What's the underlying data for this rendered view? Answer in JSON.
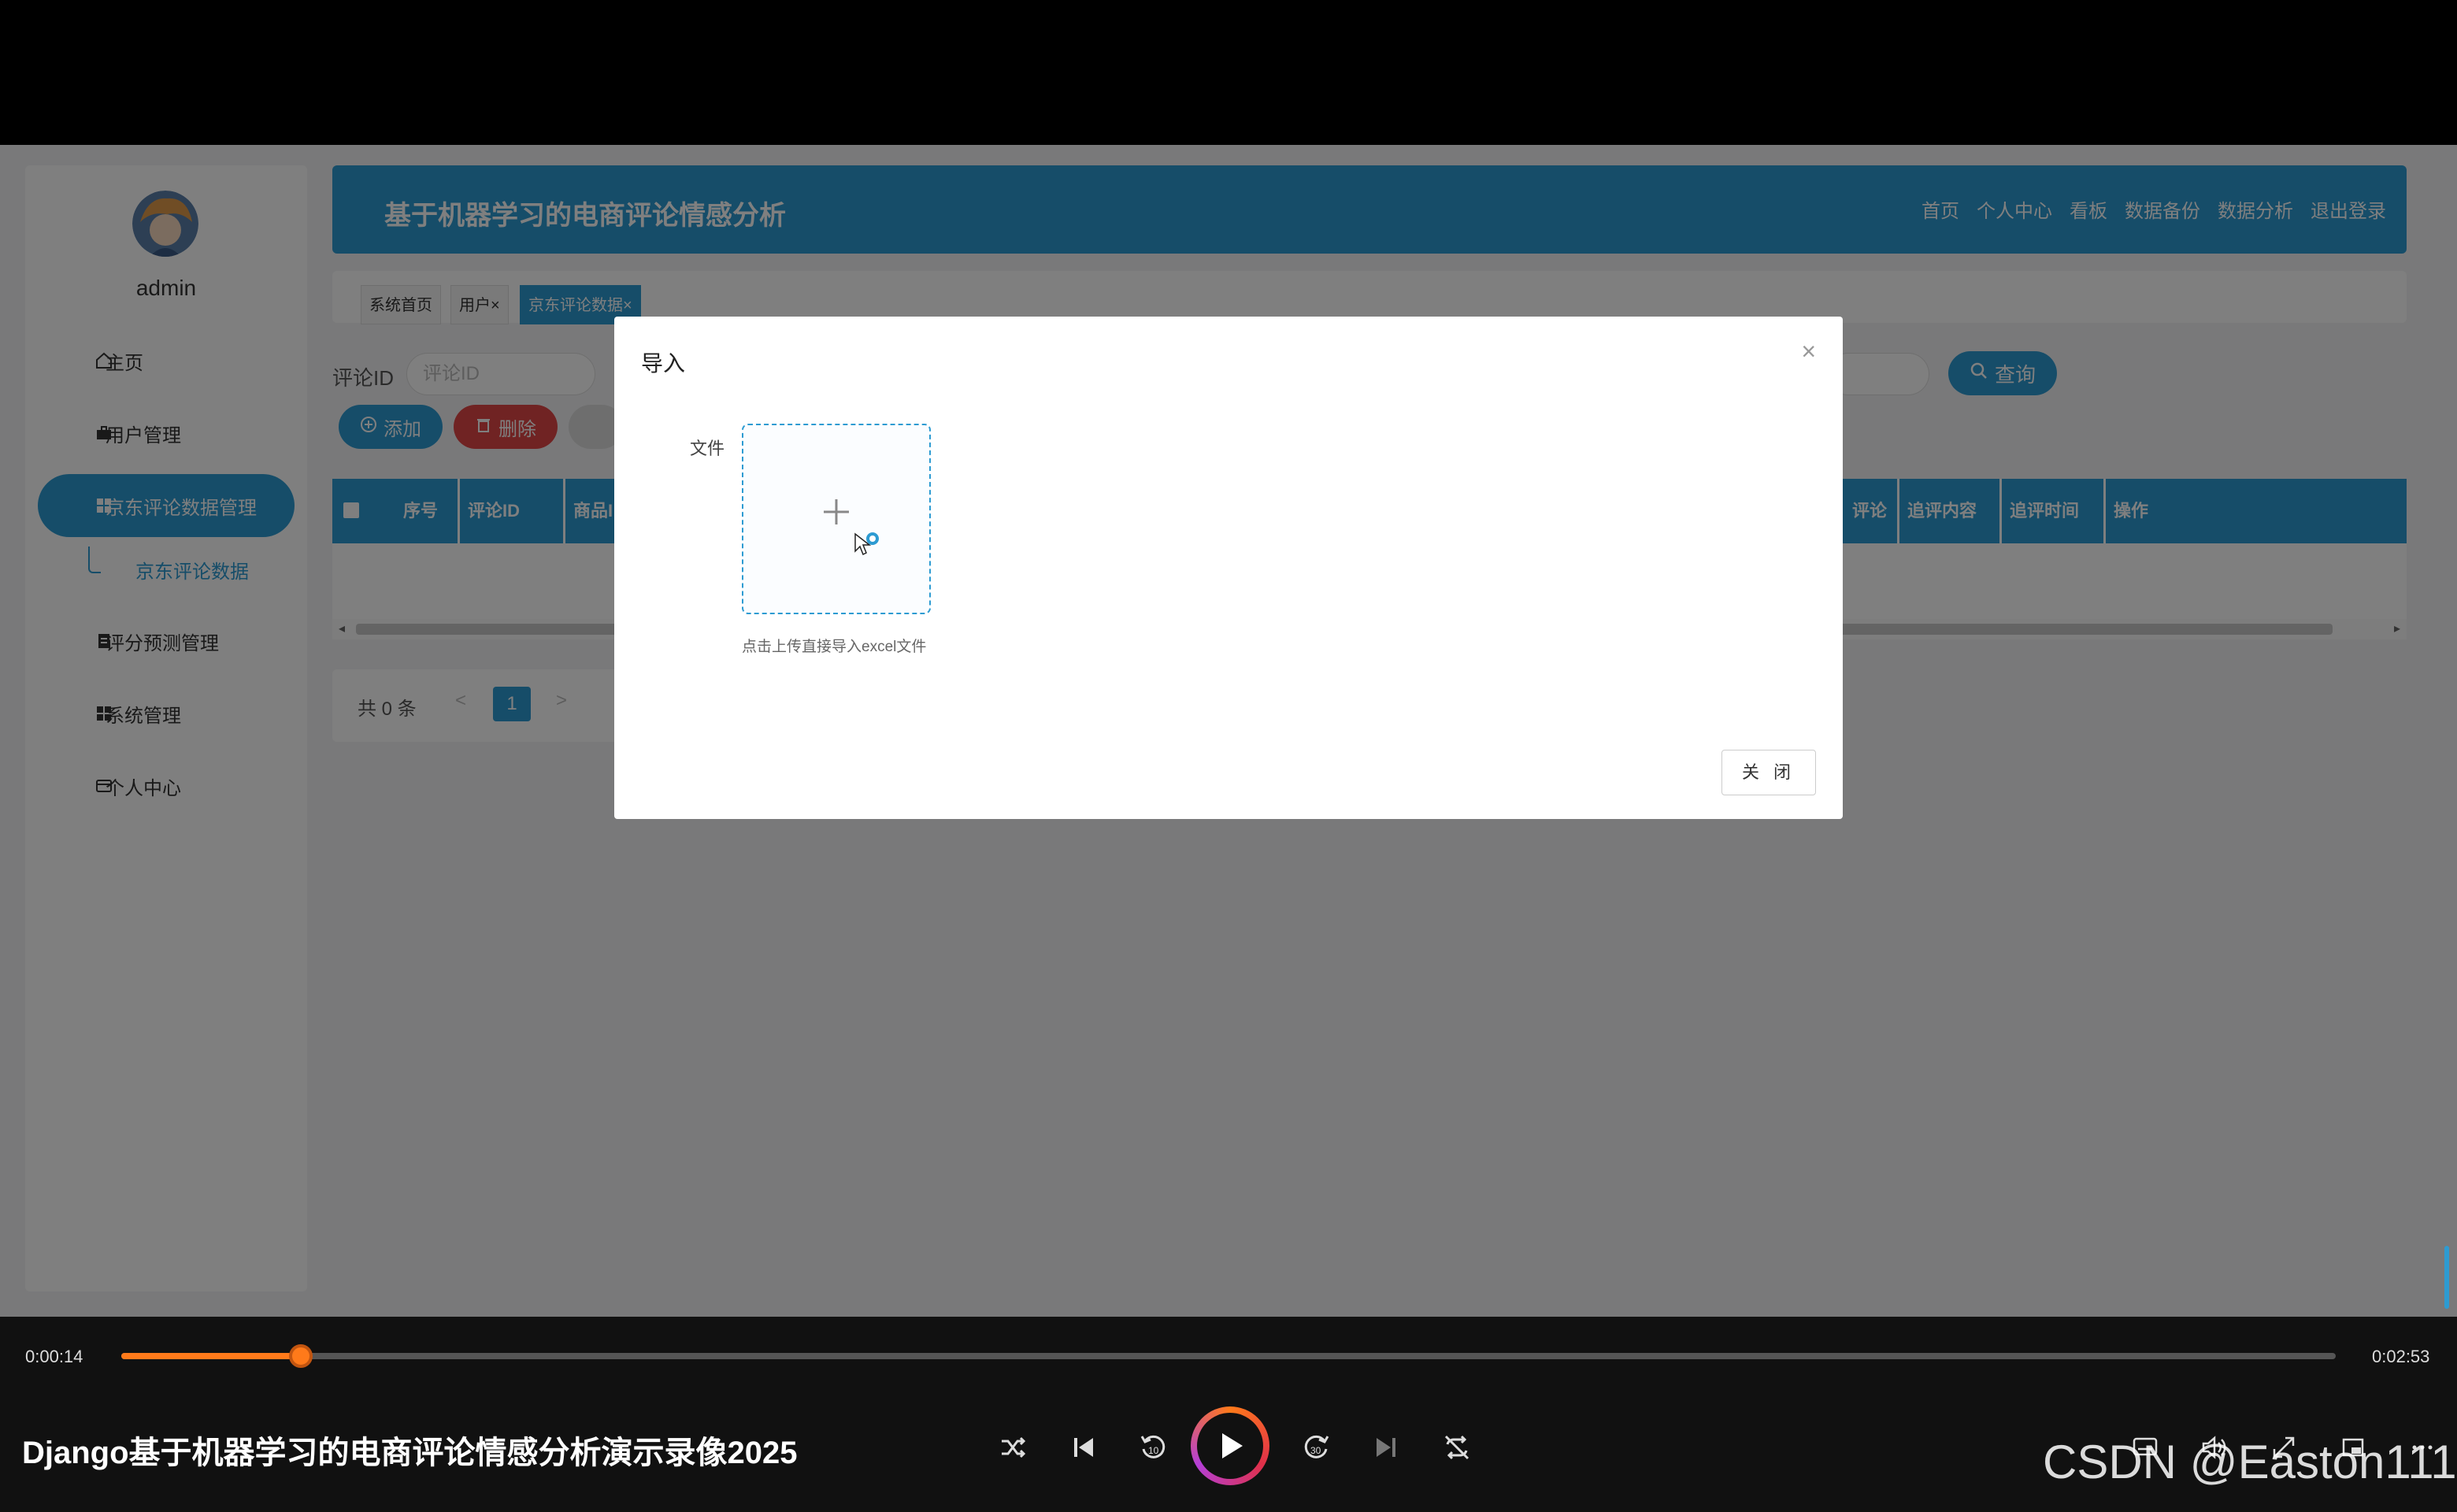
{
  "colors": {
    "primary": "#2d9bd2",
    "danger": "#e04747",
    "player_accent": "#ff7a1a"
  },
  "sidebar": {
    "username": "admin",
    "items": [
      {
        "label": "主页",
        "icon": "home-icon"
      },
      {
        "label": "用户管理",
        "icon": "briefcase-icon"
      },
      {
        "label": "京东评论数据管理",
        "icon": "grid-icon",
        "active": true
      },
      {
        "label": "评分预测管理",
        "icon": "clipboard-icon"
      },
      {
        "label": "系统管理",
        "icon": "grid-icon"
      },
      {
        "label": "个人中心",
        "icon": "card-icon"
      }
    ],
    "sub_item": "京东评论数据"
  },
  "header": {
    "title": "基于机器学习的电商评论情感分析",
    "nav": [
      "首页",
      "个人中心",
      "看板",
      "数据备份",
      "数据分析",
      "退出登录"
    ]
  },
  "tabs": [
    {
      "label": "系统首页"
    },
    {
      "label": "用户×"
    },
    {
      "label": "京东评论数据×",
      "active": true
    }
  ],
  "search": {
    "label": "评论ID",
    "placeholder": "评论ID",
    "query_button": "查询"
  },
  "actions": {
    "add": "添加",
    "delete": "删除"
  },
  "table": {
    "headers_left": [
      "序号",
      "评论ID",
      "商品I"
    ],
    "headers_right": [
      "评论",
      "追评内容",
      "追评时间",
      "操作"
    ]
  },
  "pagination": {
    "total": "共 0 条",
    "current_page": "1",
    "prev": "<",
    "next": ">"
  },
  "modal": {
    "title": "导入",
    "field_label": "文件",
    "upload_tip": "点击上传直接导入excel文件",
    "close_button": "关 闭",
    "close_icon": "×"
  },
  "player": {
    "current_time": "0:00:14",
    "total_time": "0:02:53",
    "progress": 0.081,
    "title": "Django基于机器学习的电商评论情感分析演示录像2025",
    "watermark": "CSDN @Easton111"
  }
}
